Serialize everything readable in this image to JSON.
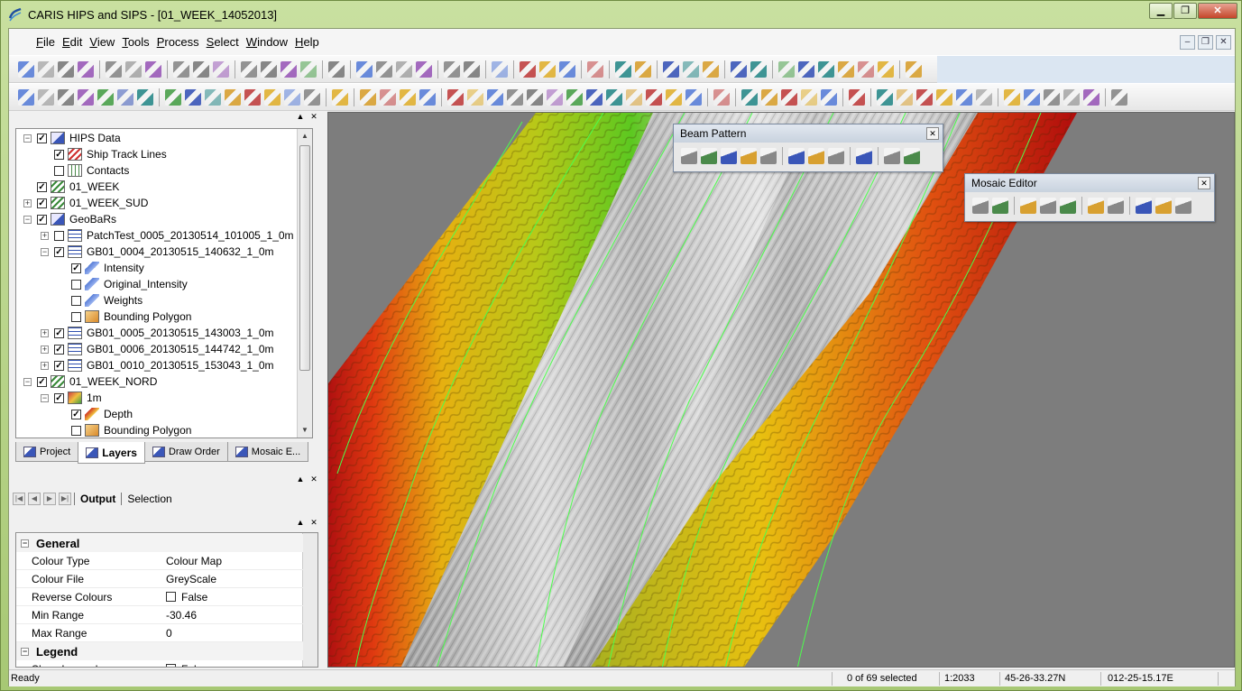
{
  "window": {
    "title": "CARIS HIPS and SIPS - [01_WEEK_14052013]"
  },
  "menu": [
    {
      "label": "File",
      "key": "F"
    },
    {
      "label": "Edit",
      "key": "E"
    },
    {
      "label": "View",
      "key": "V"
    },
    {
      "label": "Tools",
      "key": "T"
    },
    {
      "label": "Process",
      "key": "P"
    },
    {
      "label": "Select",
      "key": "S"
    },
    {
      "label": "Window",
      "key": "W"
    },
    {
      "label": "Help",
      "key": "H"
    }
  ],
  "layers": {
    "items": [
      {
        "label": "HIPS Data",
        "depth": 0,
        "expander": "-",
        "checked": true,
        "icon": "folder"
      },
      {
        "label": "Ship Track Lines",
        "depth": 1,
        "expander": "",
        "checked": true,
        "icon": "track"
      },
      {
        "label": "Contacts",
        "depth": 1,
        "expander": "",
        "checked": false,
        "icon": "contacts"
      },
      {
        "label": "01_WEEK",
        "depth": 0,
        "expander": "",
        "checked": true,
        "icon": "week"
      },
      {
        "label": "01_WEEK_SUD",
        "depth": 0,
        "expander": "+",
        "checked": true,
        "icon": "week"
      },
      {
        "label": "GeoBaRs",
        "depth": 0,
        "expander": "-",
        "checked": true,
        "icon": "folder"
      },
      {
        "label": "PatchTest_0005_20130514_101005_1_0m",
        "depth": 1,
        "expander": "+",
        "checked": false,
        "icon": "grid"
      },
      {
        "label": "GB01_0004_20130515_140632_1_0m",
        "depth": 1,
        "expander": "-",
        "checked": true,
        "icon": "grid"
      },
      {
        "label": "Intensity",
        "depth": 2,
        "expander": "",
        "checked": true,
        "icon": "layer"
      },
      {
        "label": "Original_Intensity",
        "depth": 2,
        "expander": "",
        "checked": false,
        "icon": "layer"
      },
      {
        "label": "Weights",
        "depth": 2,
        "expander": "",
        "checked": false,
        "icon": "layer"
      },
      {
        "label": "Bounding Polygon",
        "depth": 2,
        "expander": "",
        "checked": false,
        "icon": "poly"
      },
      {
        "label": "GB01_0005_20130515_143003_1_0m",
        "depth": 1,
        "expander": "+",
        "checked": true,
        "icon": "grid"
      },
      {
        "label": "GB01_0006_20130515_144742_1_0m",
        "depth": 1,
        "expander": "+",
        "checked": true,
        "icon": "grid"
      },
      {
        "label": "GB01_0010_20130515_153043_1_0m",
        "depth": 1,
        "expander": "+",
        "checked": true,
        "icon": "grid"
      },
      {
        "label": "01_WEEK_NORD",
        "depth": 0,
        "expander": "-",
        "checked": true,
        "icon": "week"
      },
      {
        "label": "1m",
        "depth": 1,
        "expander": "-",
        "checked": true,
        "icon": "meter"
      },
      {
        "label": "Depth",
        "depth": 2,
        "expander": "",
        "checked": true,
        "icon": "depth"
      },
      {
        "label": "Bounding Polygon",
        "depth": 2,
        "expander": "",
        "checked": false,
        "icon": "poly"
      }
    ]
  },
  "panel_tabs": [
    {
      "label": "Project",
      "active": false
    },
    {
      "label": "Layers",
      "active": true
    },
    {
      "label": "Draw Order",
      "active": false
    },
    {
      "label": "Mosaic E...",
      "active": false
    }
  ],
  "output_tabs": [
    {
      "label": "Output",
      "active": true
    },
    {
      "label": "Selection",
      "active": false
    }
  ],
  "properties": {
    "general_label": "General",
    "rows": [
      {
        "key": "Colour Type",
        "value": "Colour Map"
      },
      {
        "key": "Colour File",
        "value": "GreyScale"
      },
      {
        "key": "Reverse Colours",
        "value": "False",
        "checkbox": true
      },
      {
        "key": "Min Range",
        "value": "-30.46"
      },
      {
        "key": "Max Range",
        "value": "0"
      }
    ],
    "legend_label": "Legend",
    "legend_rows": [
      {
        "key": "Show Legend",
        "value": "False",
        "checkbox": true
      }
    ]
  },
  "beam_pattern": {
    "title": "Beam Pattern"
  },
  "mosaic_editor": {
    "title": "Mosaic Editor"
  },
  "status": {
    "ready": "Ready",
    "selected": "0 of 69 selected",
    "scale": "1:2033",
    "lat": "45-26-33.27N",
    "lon": "012-25-15.17E"
  },
  "colors": {
    "frame": "#b6d48a",
    "map_background": "#7d7d7d",
    "track_line": "#4cff4c"
  }
}
